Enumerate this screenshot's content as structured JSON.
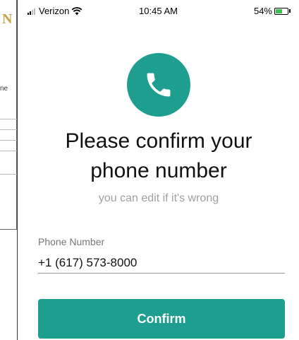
{
  "status_bar": {
    "carrier": "Verizon",
    "time": "10:45 AM",
    "battery_percent": "54%",
    "battery_level": 0.54
  },
  "background_app": {
    "text_fragment": "ne"
  },
  "confirm_dialog": {
    "title_line1": "Please confirm your",
    "title_line2": "phone number",
    "subtitle": "you can edit if it's wrong",
    "phone_label": "Phone Number",
    "phone_value": "+1 (617) 573-8000",
    "confirm_label": "Confirm"
  },
  "colors": {
    "accent": "#1e9e8e",
    "battery_green": "#39c24a"
  },
  "icons": {
    "phone": "phone-handset-icon",
    "wifi": "wifi-icon",
    "battery": "battery-charging-icon"
  }
}
